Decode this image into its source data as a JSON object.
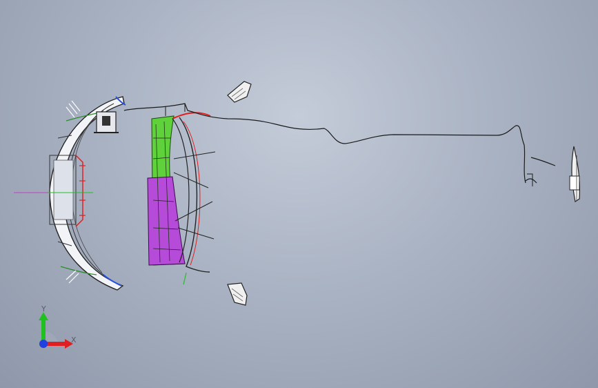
{
  "view": {
    "background": "#aab3c3"
  },
  "triad": {
    "x_label": "X",
    "y_label": "Y",
    "x_color": "#e02020",
    "y_color": "#20c020",
    "z_color": "#2040e0",
    "label_color": "#5a5a6a"
  },
  "parts": {
    "bumper_fascia_color": "#ffffff",
    "outline_color": "#222222",
    "beam_green": "#5fd13a",
    "beam_purple": "#b64ad9",
    "accent_red": "#e02020",
    "accent_blue": "#2850e0"
  }
}
